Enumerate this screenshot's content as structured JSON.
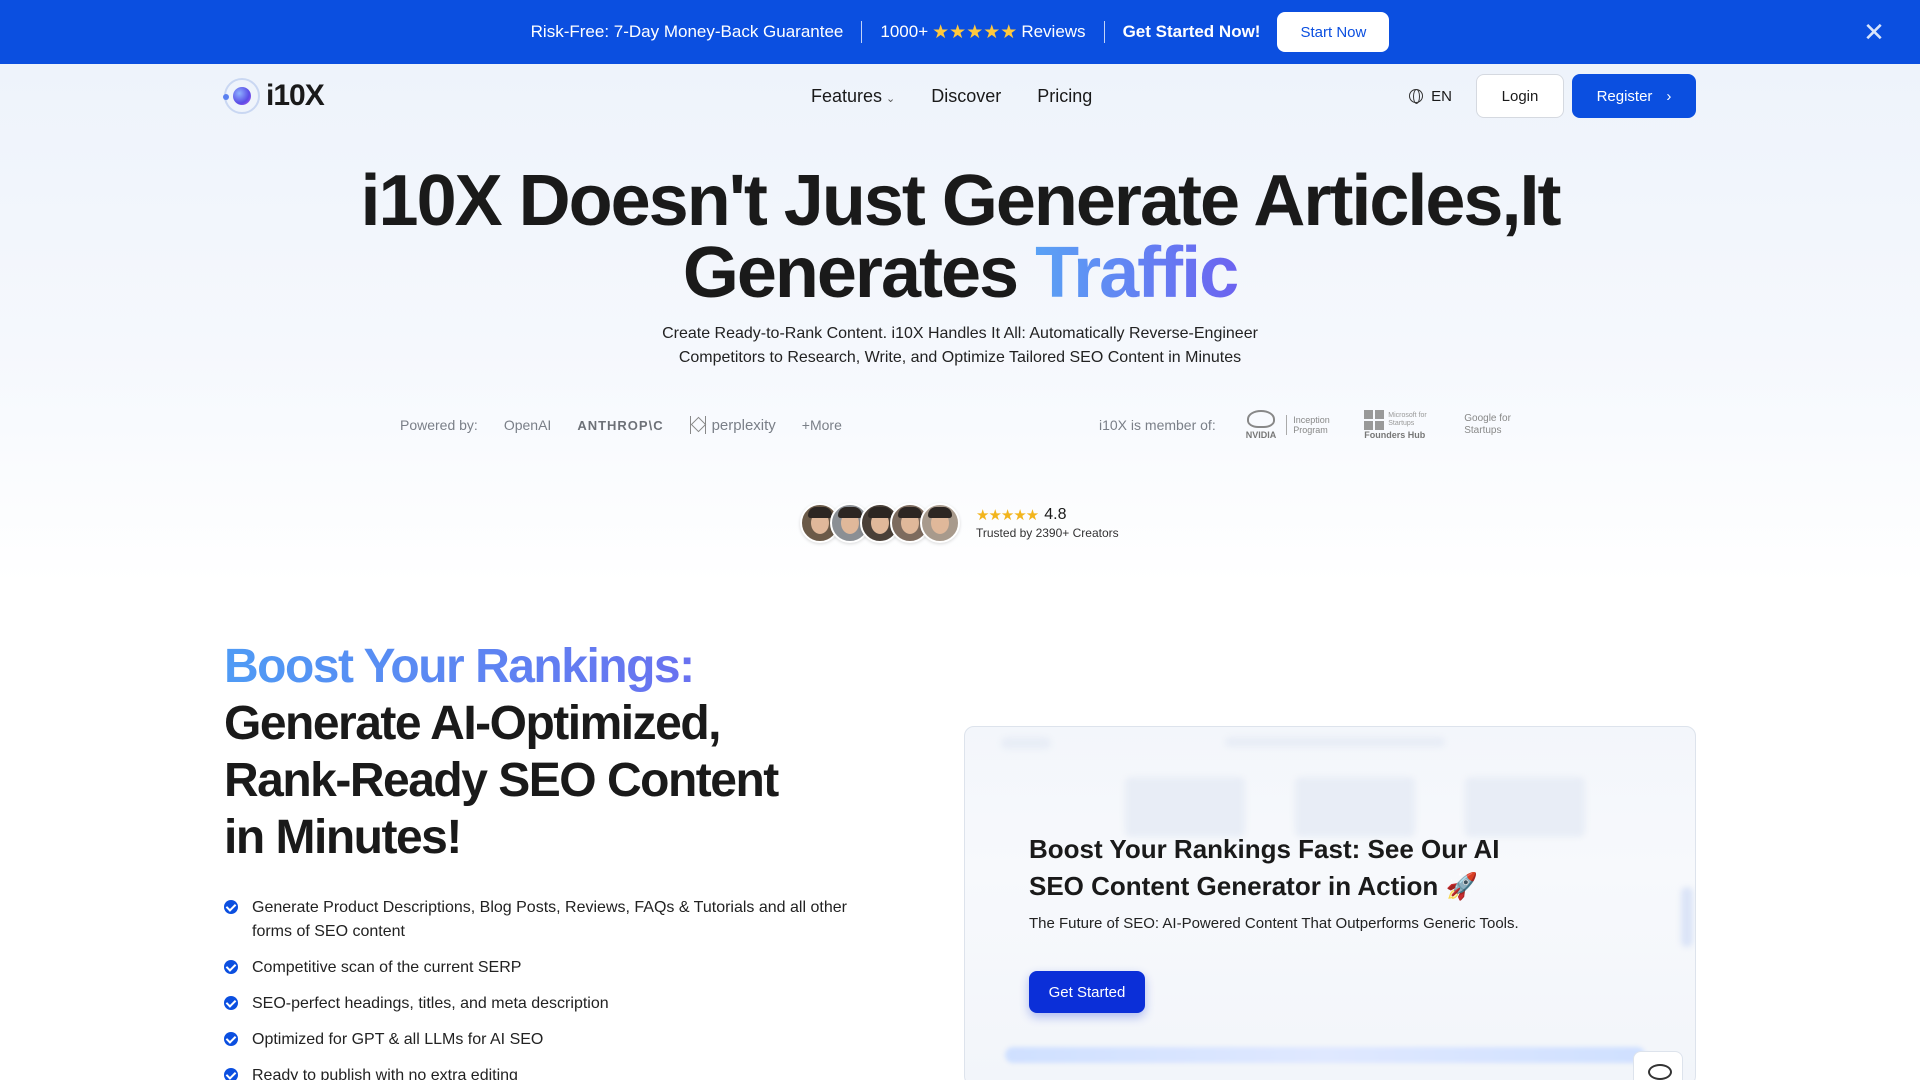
{
  "promo": {
    "guarantee": "Risk-Free: 7-Day Money-Back Guarantee",
    "reviews_count": "1000+",
    "reviews_stars": "★★★★★",
    "reviews_label": "Reviews",
    "cta_text": "Get Started Now!",
    "start_button": "Start Now",
    "close_glyph": "✕"
  },
  "nav": {
    "logo_text": "i10X",
    "links": [
      "Features",
      "Discover",
      "Pricing"
    ],
    "features_chevron": "⌄",
    "language": "EN",
    "login": "Login",
    "register": "Register",
    "register_arrow": "›"
  },
  "hero": {
    "title_line1": "i10X Doesn't Just Generate Articles,It",
    "title_line2_plain": "Generates ",
    "title_line2_accent": "Traffic",
    "subtitle_line1": "Create Ready-to-Rank Content. i10X Handles It All: Automatically Reverse-Engineer",
    "subtitle_line2": "Competitors to Research, Write, and Optimize Tailored SEO Content in Minutes"
  },
  "powered": {
    "label": "Powered by:",
    "brands": [
      "OpenAI",
      "ANTHROP\\C",
      "perplexity",
      "+More"
    ]
  },
  "member": {
    "label": "i10X is member of:",
    "nvidia": "NVIDIA",
    "nvidia_program": "Inception Program",
    "ms_small": "Microsoft for Startups",
    "ms_hub": "Founders Hub",
    "google": "Google for Startups"
  },
  "trust": {
    "stars": "★★★★★",
    "rating": "4.8",
    "text": "Trusted by 2390+ Creators"
  },
  "section": {
    "title_accent": "Boost Your Rankings:",
    "title_rest_1": "Generate AI-Optimized,",
    "title_rest_2": "Rank-Ready SEO Content",
    "title_rest_3": "in Minutes!",
    "features": [
      "Generate Product Descriptions, Blog Posts, Reviews, FAQs & Tutorials and all other forms of SEO content",
      "Competitive scan of the current SERP",
      "SEO-perfect headings, titles, and meta description",
      "Optimized for GPT & all LLMs for AI SEO",
      "Ready to publish with no extra editing"
    ]
  },
  "demo": {
    "title": "Boost Your Rankings Fast: See Our AI SEO Content Generator in Action",
    "title_emoji": "🚀",
    "subtitle": "The Future of SEO: AI-Powered Content That Outperforms Generic Tools.",
    "button": "Get Started"
  },
  "colors": {
    "brand_blue": "#0b4fe0",
    "star_yellow": "#ffc83d",
    "accent_gradient_start": "#5aa2f5",
    "accent_gradient_end": "#6c63f0"
  }
}
